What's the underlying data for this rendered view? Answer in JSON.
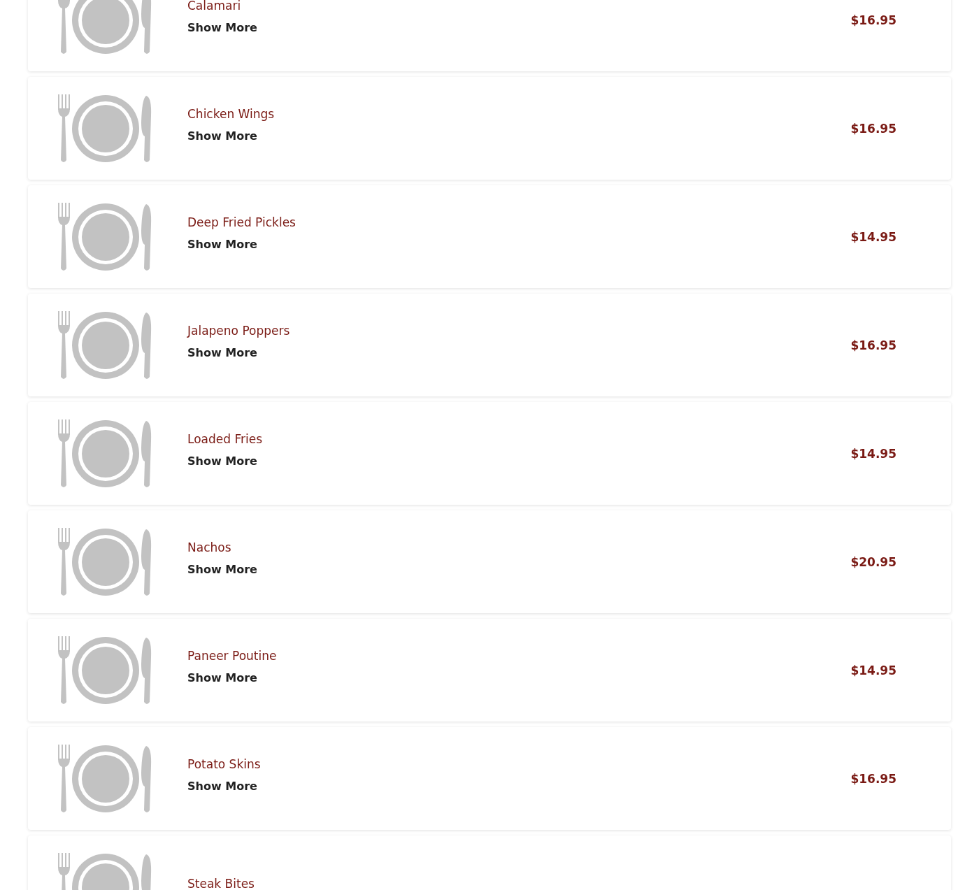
{
  "menu_items": [
    {
      "name": "Calamari",
      "action": "Show More",
      "price": "$16.95"
    },
    {
      "name": "Chicken Wings",
      "action": "Show More",
      "price": "$16.95"
    },
    {
      "name": "Deep Fried Pickles",
      "action": "Show More",
      "price": "$14.95"
    },
    {
      "name": "Jalapeno Poppers",
      "action": "Show More",
      "price": "$16.95"
    },
    {
      "name": "Loaded Fries",
      "action": "Show More",
      "price": "$14.95"
    },
    {
      "name": "Nachos",
      "action": "Show More",
      "price": "$20.95"
    },
    {
      "name": "Paneer Poutine",
      "action": "Show More",
      "price": "$14.95"
    },
    {
      "name": "Potato Skins",
      "action": "Show More",
      "price": "$16.95"
    },
    {
      "name": "Steak Bites"
    }
  ]
}
